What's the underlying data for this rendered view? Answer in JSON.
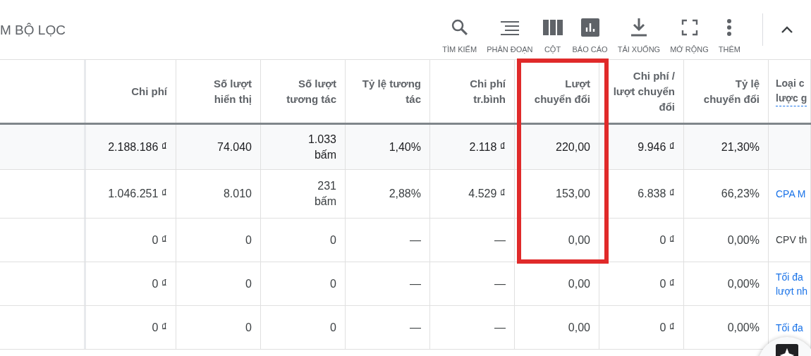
{
  "toolbar": {
    "filter_label": "M BỘ LỌC",
    "actions": [
      {
        "kind": "search",
        "label": "TÌM KIẾM"
      },
      {
        "kind": "segment",
        "label": "PHÂN ĐOẠN"
      },
      {
        "kind": "columns",
        "label": "CỘT"
      },
      {
        "kind": "report",
        "label": "BÁO CÁO"
      },
      {
        "kind": "download",
        "label": "TẢI XUỐNG"
      },
      {
        "kind": "expand",
        "label": "MỞ RỘNG"
      },
      {
        "kind": "more",
        "label": "THÊM"
      }
    ]
  },
  "table": {
    "columns": [
      {
        "label": [
          "Chi phí"
        ],
        "highlighted": false
      },
      {
        "label": [
          "Số lượt",
          "hiển thị"
        ],
        "highlighted": false
      },
      {
        "label": [
          "Số lượt",
          "tương tác"
        ],
        "highlighted": false
      },
      {
        "label": [
          "Tỷ lệ tương",
          "tác"
        ],
        "highlighted": false
      },
      {
        "label": [
          "Chi phí",
          "tr.bình"
        ],
        "highlighted": false
      },
      {
        "label": [
          "Lượt",
          "chuyển đổi"
        ],
        "highlighted": true
      },
      {
        "label": [
          "Chi phí /",
          "lượt chuyển",
          "đổi"
        ],
        "highlighted": false
      },
      {
        "label": [
          "Tỷ lệ",
          "chuyển đổi"
        ],
        "highlighted": false
      },
      {
        "label": [
          "Loại c",
          "lược g"
        ],
        "highlighted": false,
        "kind": "text-left"
      }
    ],
    "rows": [
      {
        "kind": "total",
        "cells": [
          [
            "2.188.186 ₫"
          ],
          [
            "74.040"
          ],
          [
            "1.033",
            "bấm"
          ],
          [
            "1,40%"
          ],
          [
            "2.118 ₫"
          ],
          [
            "220,00"
          ],
          [
            "9.946 ₫"
          ],
          [
            "21,30%"
          ]
        ],
        "strategy": null
      },
      {
        "kind": "row",
        "cells": [
          [
            "1.046.251 ₫"
          ],
          [
            "8.010"
          ],
          [
            "231",
            "bấm"
          ],
          [
            "2,88%"
          ],
          [
            "4.529 ₫"
          ],
          [
            "153,00"
          ],
          [
            "6.838 ₫"
          ],
          [
            "66,23%"
          ]
        ],
        "strategy": {
          "kind": "link",
          "text": [
            "CPA M"
          ]
        }
      },
      {
        "kind": "row",
        "cells": [
          [
            "0 ₫"
          ],
          [
            "0"
          ],
          [
            "0"
          ],
          [
            "—"
          ],
          [
            "—"
          ],
          [
            "0,00"
          ],
          [
            "0 ₫"
          ],
          [
            "0,00%"
          ]
        ],
        "strategy": {
          "kind": "text",
          "text": [
            "CPV th"
          ]
        }
      },
      {
        "kind": "row",
        "cells": [
          [
            "0 ₫"
          ],
          [
            "0"
          ],
          [
            "0"
          ],
          [
            "—"
          ],
          [
            "—"
          ],
          [
            "0,00"
          ],
          [
            "0 ₫"
          ],
          [
            "0,00%"
          ]
        ],
        "strategy": {
          "kind": "link",
          "text": [
            "Tối đa",
            "lượt nh"
          ]
        }
      },
      {
        "kind": "row",
        "cells": [
          [
            "0 ₫"
          ],
          [
            "0"
          ],
          [
            "0"
          ],
          [
            "—"
          ],
          [
            "—"
          ],
          [
            "0,00"
          ],
          [
            "0 ₫"
          ],
          [
            "0,00%"
          ]
        ],
        "strategy": {
          "kind": "link",
          "text": [
            "Tối đa"
          ]
        }
      }
    ]
  }
}
